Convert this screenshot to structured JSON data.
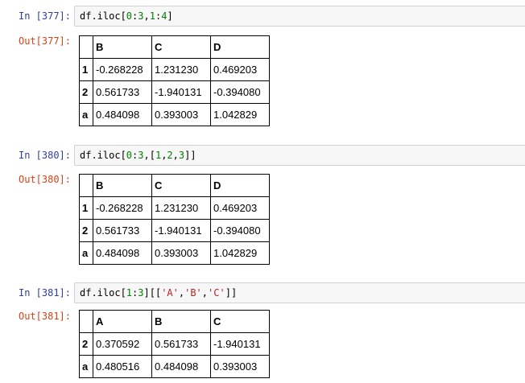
{
  "cells": [
    {
      "in_prompt": "In  [377]:",
      "code": [
        "df.iloc[",
        "0",
        ":",
        "3",
        ",",
        "1",
        ":",
        "4",
        "]"
      ],
      "out_prompt": "Out[377]:",
      "columns": [
        "B",
        "C",
        "D"
      ],
      "rows": [
        {
          "index": "1",
          "values": [
            "-0.268228",
            "1.231230",
            "0.469203"
          ]
        },
        {
          "index": "2",
          "values": [
            "0.561733",
            "-1.940131",
            "-0.394080"
          ]
        },
        {
          "index": "a",
          "values": [
            "0.484098",
            "0.393003",
            "1.042829"
          ]
        }
      ]
    },
    {
      "in_prompt": "In  [380]:",
      "code": [
        "df.iloc[",
        "0",
        ":",
        "3",
        ",[",
        "1",
        ",",
        "2",
        ",",
        "3",
        "]]"
      ],
      "out_prompt": "Out[380]:",
      "columns": [
        "B",
        "C",
        "D"
      ],
      "rows": [
        {
          "index": "1",
          "values": [
            "-0.268228",
            "1.231230",
            "0.469203"
          ]
        },
        {
          "index": "2",
          "values": [
            "0.561733",
            "-1.940131",
            "-0.394080"
          ]
        },
        {
          "index": "a",
          "values": [
            "0.484098",
            "0.393003",
            "1.042829"
          ]
        }
      ]
    },
    {
      "in_prompt": "In  [381]:",
      "code": [
        "df.iloc[",
        "1",
        ":",
        "3",
        "][[",
        "'A'",
        ",",
        "'B'",
        ",",
        "'C'",
        "]]"
      ],
      "out_prompt": "Out[381]:",
      "columns": [
        "A",
        "B",
        "C"
      ],
      "rows": [
        {
          "index": "2",
          "values": [
            "0.370592",
            "0.561733",
            "-1.940131"
          ]
        },
        {
          "index": "a",
          "values": [
            "0.480516",
            "0.484098",
            "0.393003"
          ]
        }
      ]
    }
  ],
  "colors": {
    "in_prompt": "#303f9f",
    "out_prompt": "#d84315",
    "number": "#008000",
    "string": "#ba2121"
  }
}
